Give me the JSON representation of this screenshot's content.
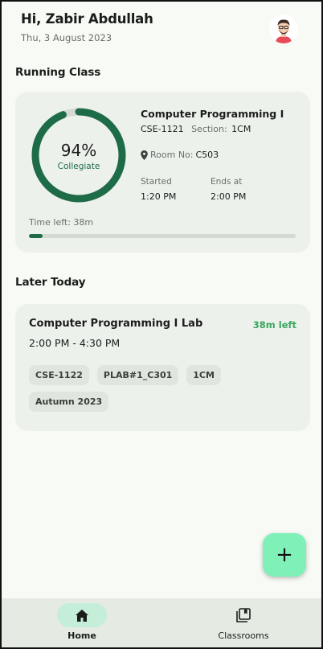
{
  "header": {
    "greeting": "Hi, Zabir Abdullah",
    "date": "Thu, 3 August 2023",
    "avatar_icon": "user-avatar-icon"
  },
  "running": {
    "section_title": "Running Class",
    "attendance_percent": 94,
    "attendance_label": "94%",
    "grade": "Collegiate",
    "course_title": "Computer Programming I",
    "course_code": "CSE-1121",
    "section_label": "Section:",
    "section_value": "1CM",
    "room_label": "Room No:",
    "room_value": "C503",
    "started_label": "Started",
    "started_time": "1:20 PM",
    "ends_label": "Ends at",
    "ends_time": "2:00 PM",
    "time_left": "Time left: 38m",
    "progress_fraction": 0.05,
    "accent": "#1e6b48"
  },
  "later": {
    "section_title": "Later Today",
    "course_title": "Computer Programming I Lab",
    "time_left": "38m left",
    "time_range": "2:00 PM - 4:30 PM",
    "chips": [
      "CSE-1122",
      "PLAB#1_C301",
      "1CM",
      "Autumn 2023"
    ],
    "time_left_color": "#3aa65c"
  },
  "fab": {
    "label": "+",
    "icon": "plus-icon",
    "color": "#7ef0b8"
  },
  "nav": {
    "home_label": "Home",
    "home_icon": "home-icon",
    "classrooms_label": "Classrooms",
    "classrooms_icon": "classrooms-icon"
  }
}
